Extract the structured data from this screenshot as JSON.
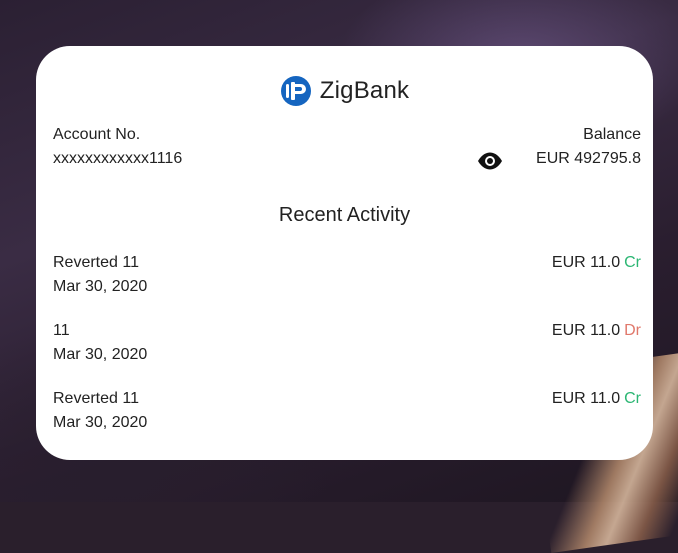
{
  "brand": {
    "name": "ZigBank"
  },
  "account": {
    "number_label": "Account No.",
    "number": "xxxxxxxxxxxx1116",
    "balance_label": "Balance",
    "balance": "EUR 492795.8"
  },
  "recent": {
    "title": "Recent Activity",
    "transactions": [
      {
        "description": "Reverted 11",
        "date": "Mar 30, 2020",
        "amount": "EUR 11.0",
        "type": "Cr"
      },
      {
        "description": "11",
        "date": "Mar 30, 2020",
        "amount": "EUR 11.0",
        "type": "Dr"
      },
      {
        "description": "Reverted 11",
        "date": "Mar 30, 2020",
        "amount": "EUR 11.0",
        "type": "Cr"
      }
    ]
  },
  "colors": {
    "credit": "#2bb673",
    "debit": "#e0786b",
    "brand_blue": "#1565c0",
    "card": "#ffffff"
  },
  "icons": {
    "brand": "zigbank-logo-icon",
    "toggle_balance": "eye-icon"
  }
}
